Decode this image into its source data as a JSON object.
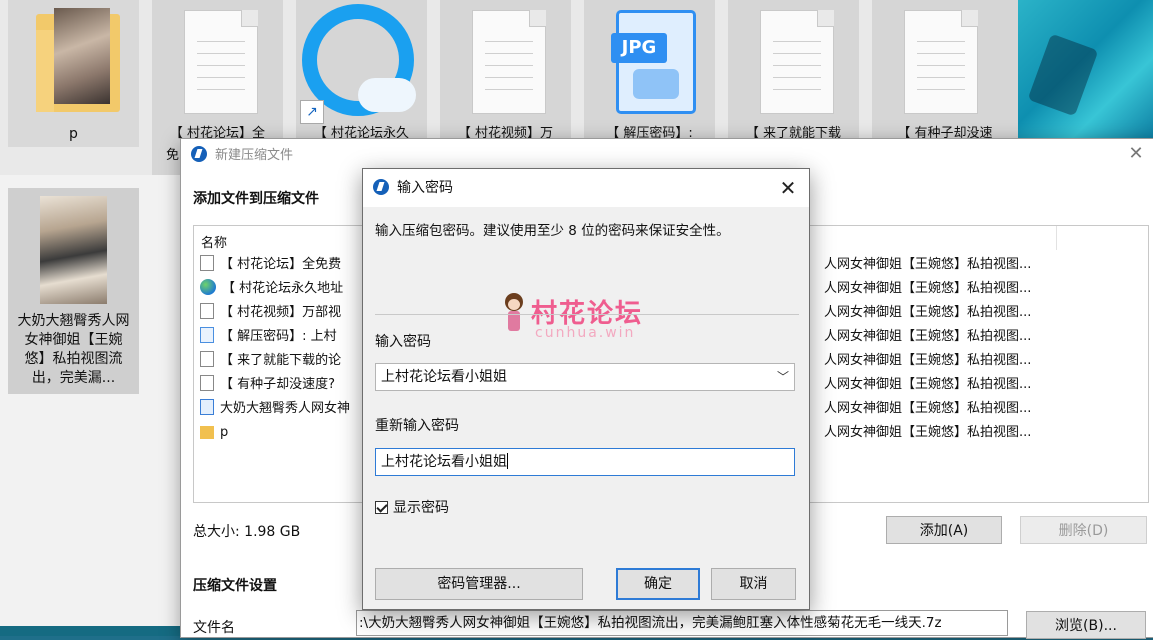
{
  "desktop": {
    "folder_label": "p",
    "photo_label": "大奶大翘臀秀人网女神御姐【王婉悠】私拍视图流出，完美漏...",
    "tiles": [
      {
        "label": "【 村花论坛】全"
      },
      {
        "label": "【 村花论坛永久"
      },
      {
        "label": "【 村花视频】万"
      },
      {
        "label": "【 解压密码】:"
      },
      {
        "label": "【 来了就能下载"
      },
      {
        "label": "【 有种子却没速"
      }
    ],
    "jpg_badge": "JPG",
    "tile_fragment": "免"
  },
  "main_window": {
    "title": "新建压缩文件",
    "section_add": "添加文件到压缩文件",
    "column_name": "名称",
    "rows": [
      {
        "name": "【 村花论坛】全免费",
        "icon": "text-file-icon"
      },
      {
        "name": "【 村花论坛永久地址",
        "icon": "globe-icon"
      },
      {
        "name": "【 村花视频】万部视",
        "icon": "text-file-icon"
      },
      {
        "name": "【 解压密码】: 上村",
        "icon": "image-file-icon"
      },
      {
        "name": "【 来了就能下载的论",
        "icon": "text-file-icon"
      },
      {
        "name": "【 有种子却没速度?",
        "icon": "text-file-icon"
      },
      {
        "name": "大奶大翘臀秀人网女神",
        "icon": "archive-file-icon"
      },
      {
        "name": "p",
        "icon": "folder-icon"
      }
    ],
    "row_desc": "人网女神御姐【王婉悠】私拍视图...",
    "total_size": "总大小: 1.98 GB",
    "add_button": "添加(A)",
    "delete_button": "删除(D)",
    "section_settings": "压缩文件设置",
    "filename_label": "文件名",
    "filename_value": ":\\大奶大翘臀秀人网女神御姐【王婉悠】私拍视图流出，完美漏鲍肛塞入体性感菊花无毛一线天.7z",
    "browse_button": "浏览(B)..."
  },
  "password_dialog": {
    "title": "输入密码",
    "description": "输入压缩包密码。建议使用至少 8 位的密码来保证安全性。",
    "password_label": "输入密码",
    "password_value": "上村花论坛看小姐姐",
    "confirm_label": "重新输入密码",
    "confirm_value": "上村花论坛看小姐姐",
    "show_password_label": "显示密码",
    "show_password_checked": true,
    "manager_button": "密码管理器...",
    "ok_button": "确定",
    "cancel_button": "取消"
  },
  "watermark": {
    "text": "村花论坛",
    "sub": "cunhua.win"
  }
}
